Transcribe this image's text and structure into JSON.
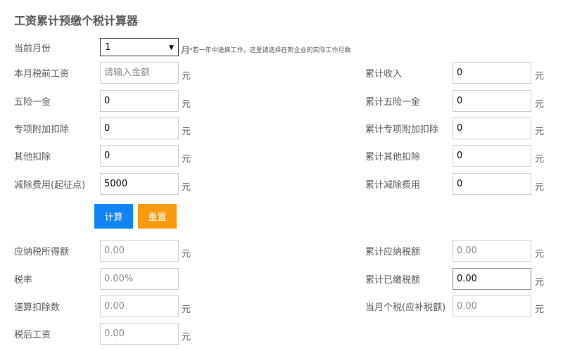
{
  "title": "工资累计预缴个税计算器",
  "month": {
    "label": "当前月份",
    "value": "1",
    "unit": "月",
    "hint": "*若一年中途换工作，这里请选择在新企业的实际工作月数"
  },
  "unit": "元",
  "left_inputs": [
    {
      "label": "本月税前工资",
      "value": "",
      "placeholder": "请输入金额"
    },
    {
      "label": "五险一金",
      "value": "0"
    },
    {
      "label": "专项附加扣除",
      "value": "0"
    },
    {
      "label": "其他扣除",
      "value": "0"
    },
    {
      "label": "减除费用(起征点)",
      "value": "5000"
    }
  ],
  "right_inputs": [
    {
      "label": "累计收入",
      "value": "0"
    },
    {
      "label": "累计五险一金",
      "value": "0"
    },
    {
      "label": "累计专项附加扣除",
      "value": "0"
    },
    {
      "label": "累计其他扣除",
      "value": "0"
    },
    {
      "label": "累计减除费用",
      "value": "0"
    }
  ],
  "buttons": {
    "calculate": "计算",
    "reset": "重置"
  },
  "colors": {
    "calculate": "#0f84f5",
    "reset": "#fa9b0f"
  },
  "left_results": [
    {
      "label": "应纳税所得额",
      "value": "0.00"
    },
    {
      "label": "税率",
      "value": "0.00%"
    },
    {
      "label": "速算扣除数",
      "value": "0.00"
    },
    {
      "label": "税后工资",
      "value": "0.00"
    }
  ],
  "right_results": [
    {
      "label": "累计应纳税额",
      "value": "0.00"
    },
    {
      "label": "累计已缴税额",
      "value": "0.00"
    },
    {
      "label": "当月个税(应补税额)",
      "value": "0.00"
    }
  ]
}
